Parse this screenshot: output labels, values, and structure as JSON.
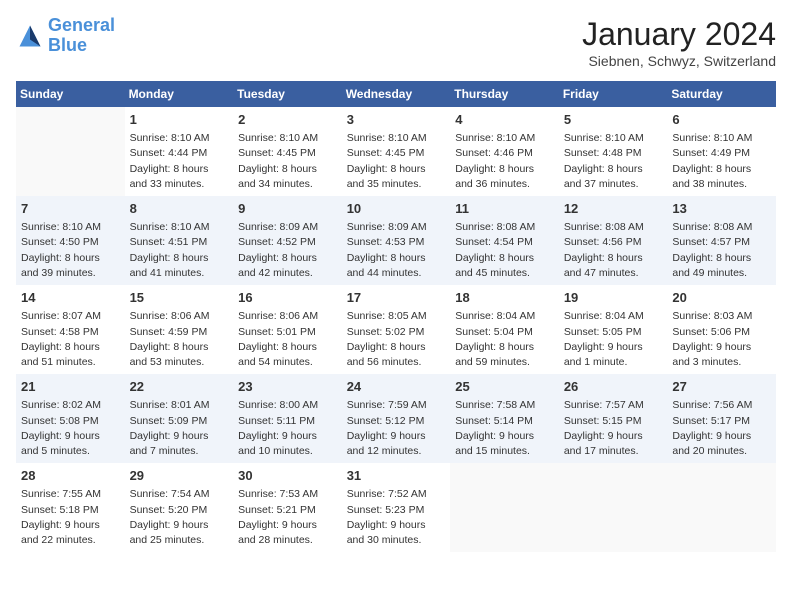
{
  "logo": {
    "line1": "General",
    "line2": "Blue"
  },
  "title": "January 2024",
  "location": "Siebnen, Schwyz, Switzerland",
  "days_header": [
    "Sunday",
    "Monday",
    "Tuesday",
    "Wednesday",
    "Thursday",
    "Friday",
    "Saturday"
  ],
  "weeks": [
    [
      {
        "num": "",
        "info": ""
      },
      {
        "num": "1",
        "info": "Sunrise: 8:10 AM\nSunset: 4:44 PM\nDaylight: 8 hours\nand 33 minutes."
      },
      {
        "num": "2",
        "info": "Sunrise: 8:10 AM\nSunset: 4:45 PM\nDaylight: 8 hours\nand 34 minutes."
      },
      {
        "num": "3",
        "info": "Sunrise: 8:10 AM\nSunset: 4:45 PM\nDaylight: 8 hours\nand 35 minutes."
      },
      {
        "num": "4",
        "info": "Sunrise: 8:10 AM\nSunset: 4:46 PM\nDaylight: 8 hours\nand 36 minutes."
      },
      {
        "num": "5",
        "info": "Sunrise: 8:10 AM\nSunset: 4:48 PM\nDaylight: 8 hours\nand 37 minutes."
      },
      {
        "num": "6",
        "info": "Sunrise: 8:10 AM\nSunset: 4:49 PM\nDaylight: 8 hours\nand 38 minutes."
      }
    ],
    [
      {
        "num": "7",
        "info": "Sunrise: 8:10 AM\nSunset: 4:50 PM\nDaylight: 8 hours\nand 39 minutes."
      },
      {
        "num": "8",
        "info": "Sunrise: 8:10 AM\nSunset: 4:51 PM\nDaylight: 8 hours\nand 41 minutes."
      },
      {
        "num": "9",
        "info": "Sunrise: 8:09 AM\nSunset: 4:52 PM\nDaylight: 8 hours\nand 42 minutes."
      },
      {
        "num": "10",
        "info": "Sunrise: 8:09 AM\nSunset: 4:53 PM\nDaylight: 8 hours\nand 44 minutes."
      },
      {
        "num": "11",
        "info": "Sunrise: 8:08 AM\nSunset: 4:54 PM\nDaylight: 8 hours\nand 45 minutes."
      },
      {
        "num": "12",
        "info": "Sunrise: 8:08 AM\nSunset: 4:56 PM\nDaylight: 8 hours\nand 47 minutes."
      },
      {
        "num": "13",
        "info": "Sunrise: 8:08 AM\nSunset: 4:57 PM\nDaylight: 8 hours\nand 49 minutes."
      }
    ],
    [
      {
        "num": "14",
        "info": "Sunrise: 8:07 AM\nSunset: 4:58 PM\nDaylight: 8 hours\nand 51 minutes."
      },
      {
        "num": "15",
        "info": "Sunrise: 8:06 AM\nSunset: 4:59 PM\nDaylight: 8 hours\nand 53 minutes."
      },
      {
        "num": "16",
        "info": "Sunrise: 8:06 AM\nSunset: 5:01 PM\nDaylight: 8 hours\nand 54 minutes."
      },
      {
        "num": "17",
        "info": "Sunrise: 8:05 AM\nSunset: 5:02 PM\nDaylight: 8 hours\nand 56 minutes."
      },
      {
        "num": "18",
        "info": "Sunrise: 8:04 AM\nSunset: 5:04 PM\nDaylight: 8 hours\nand 59 minutes."
      },
      {
        "num": "19",
        "info": "Sunrise: 8:04 AM\nSunset: 5:05 PM\nDaylight: 9 hours\nand 1 minute."
      },
      {
        "num": "20",
        "info": "Sunrise: 8:03 AM\nSunset: 5:06 PM\nDaylight: 9 hours\nand 3 minutes."
      }
    ],
    [
      {
        "num": "21",
        "info": "Sunrise: 8:02 AM\nSunset: 5:08 PM\nDaylight: 9 hours\nand 5 minutes."
      },
      {
        "num": "22",
        "info": "Sunrise: 8:01 AM\nSunset: 5:09 PM\nDaylight: 9 hours\nand 7 minutes."
      },
      {
        "num": "23",
        "info": "Sunrise: 8:00 AM\nSunset: 5:11 PM\nDaylight: 9 hours\nand 10 minutes."
      },
      {
        "num": "24",
        "info": "Sunrise: 7:59 AM\nSunset: 5:12 PM\nDaylight: 9 hours\nand 12 minutes."
      },
      {
        "num": "25",
        "info": "Sunrise: 7:58 AM\nSunset: 5:14 PM\nDaylight: 9 hours\nand 15 minutes."
      },
      {
        "num": "26",
        "info": "Sunrise: 7:57 AM\nSunset: 5:15 PM\nDaylight: 9 hours\nand 17 minutes."
      },
      {
        "num": "27",
        "info": "Sunrise: 7:56 AM\nSunset: 5:17 PM\nDaylight: 9 hours\nand 20 minutes."
      }
    ],
    [
      {
        "num": "28",
        "info": "Sunrise: 7:55 AM\nSunset: 5:18 PM\nDaylight: 9 hours\nand 22 minutes."
      },
      {
        "num": "29",
        "info": "Sunrise: 7:54 AM\nSunset: 5:20 PM\nDaylight: 9 hours\nand 25 minutes."
      },
      {
        "num": "30",
        "info": "Sunrise: 7:53 AM\nSunset: 5:21 PM\nDaylight: 9 hours\nand 28 minutes."
      },
      {
        "num": "31",
        "info": "Sunrise: 7:52 AM\nSunset: 5:23 PM\nDaylight: 9 hours\nand 30 minutes."
      },
      {
        "num": "",
        "info": ""
      },
      {
        "num": "",
        "info": ""
      },
      {
        "num": "",
        "info": ""
      }
    ]
  ]
}
